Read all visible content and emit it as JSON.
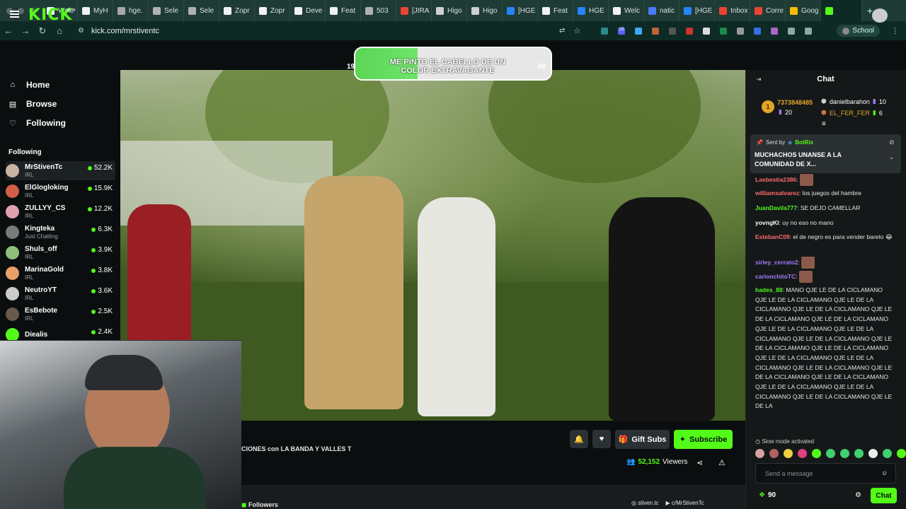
{
  "browser": {
    "tabs": [
      {
        "label": "Welc",
        "color": "#f2f2f2"
      },
      {
        "label": "MyH",
        "color": "#f2f2f2"
      },
      {
        "label": "hge.",
        "color": "#a8a8a8"
      },
      {
        "label": "Sele",
        "color": "#b0b0b0"
      },
      {
        "label": "Sele",
        "color": "#b0b0b0"
      },
      {
        "label": "Zopr",
        "color": "#f2f2f2"
      },
      {
        "label": "Zopr",
        "color": "#f2f2f2"
      },
      {
        "label": "Deve",
        "color": "#f2f2f2"
      },
      {
        "label": "Feat",
        "color": "#f2f2f2"
      },
      {
        "label": "503",
        "color": "#b0b0b0"
      },
      {
        "label": "[JIRA",
        "color": "#ea4335"
      },
      {
        "label": "Higo",
        "color": "#d0d0d0"
      },
      {
        "label": "Higo",
        "color": "#d0d0d0"
      },
      {
        "label": "[HGE",
        "color": "#2684ff"
      },
      {
        "label": "Feat",
        "color": "#f2f2f2"
      },
      {
        "label": "HGE",
        "color": "#2684ff"
      },
      {
        "label": "Welc",
        "color": "#f2f2f2"
      },
      {
        "label": "natic",
        "color": "#4a7cff"
      },
      {
        "label": "[HGE",
        "color": "#2684ff"
      },
      {
        "label": "Inbox",
        "color": "#ea4335"
      },
      {
        "label": "Corre",
        "color": "#ea4335"
      },
      {
        "label": "Goog",
        "color": "#fbbc05"
      },
      {
        "label": "",
        "color": "#53fc18"
      }
    ],
    "new_tab": "+",
    "url": "kick.com/mrstiventc",
    "profile_label": "School",
    "ext_badge": "25"
  },
  "header": {
    "logo": "KICK",
    "beta": "BETA"
  },
  "poll": {
    "question": "ME PINTO EL CABELLO DE UN COLOR EXTRAVAGANTE",
    "left_value": "19",
    "right_value": "50",
    "progress": 0.32
  },
  "sidebar": {
    "nav": [
      {
        "label": "Home",
        "icon": "home-icon"
      },
      {
        "label": "Browse",
        "icon": "browse-icon"
      },
      {
        "label": "Following",
        "icon": "heart-icon"
      }
    ],
    "following_heading": "Following",
    "following": [
      {
        "name": "MrStivenTc",
        "category": "IRL",
        "viewers": "52.2K",
        "color": "#c9b4a4"
      },
      {
        "name": "ElGlogloking",
        "category": "IRL",
        "viewers": "15.9K",
        "color": "#d45d4a"
      },
      {
        "name": "ZULLYY_CS",
        "category": "IRL",
        "viewers": "12.2K",
        "color": "#e0a0b0"
      },
      {
        "name": "Kingteka",
        "category": "Just Chatting",
        "viewers": "6.3K",
        "color": "#7a7a7a"
      },
      {
        "name": "Shuls_off",
        "category": "IRL",
        "viewers": "3.9K",
        "color": "#8ec07c"
      },
      {
        "name": "MarinaGold",
        "category": "IRL",
        "viewers": "3.8K",
        "color": "#e8a06a"
      },
      {
        "name": "NeutroYT",
        "category": "IRL",
        "viewers": "3.6K",
        "color": "#cccccc"
      },
      {
        "name": "EsBebote",
        "category": "IRL",
        "viewers": "2.5K",
        "color": "#6a5a4a"
      },
      {
        "name": "Diealis",
        "category": "",
        "viewers": "2.4K",
        "color": "#53fc18"
      }
    ]
  },
  "stream": {
    "title": "CIONES con LA BANDA Y VALLES T",
    "gift_subs": "Gift Subs",
    "subscribe": "Subscribe",
    "viewers_count": "52,152",
    "viewers_label": "Viewers",
    "followers_label": "Followers",
    "social_1": "stiven.tc",
    "social_2": "c/MrStivenTc"
  },
  "chat": {
    "title": "Chat",
    "leaderboard": {
      "top_user": "7373848485",
      "top_count": "20",
      "user_2": "danielbarahon",
      "user_2_count": "10",
      "user_3": "EL_FER_FER",
      "user_3_count": "6",
      "rank": "1"
    },
    "pinned": {
      "sent_by": "Sent by",
      "author": "BotRix",
      "message": "MUCHACHOS UNANSE A LA COMUNIDAD DE X..."
    },
    "messages": [
      {
        "user": "Lasbestia2386",
        "text": "",
        "color": "#ff6b6b"
      },
      {
        "user": "williamsalvarez",
        "text": "los juegos del hambre",
        "color": "#ff6b6b"
      },
      {
        "user": "JuanDavila777",
        "text": "SE DEJO CAMELLAR",
        "color": "#53fc18"
      },
      {
        "user": "yovngKl",
        "text": "uy no eso no mano",
        "color": "#ffffff"
      },
      {
        "user": "EstebanC09",
        "text": "el de negro es para vender bareto 😂",
        "color": "#ff6b6b"
      },
      {
        "user": "sirley_cerrato2",
        "text": "",
        "color": "#a47bff"
      },
      {
        "user": "carlonchitoTC",
        "text": "",
        "color": "#a47bff"
      },
      {
        "user": "hades_88",
        "text": "MANO QJE LE DE LA CICLAMANO QJE LE DE LA CICLAMANO QJE LE DE LA CICLAMANO QJE LE DE LA CICLAMANO QJE LE DE LA CICLAMANO QJE LE DE LA CICLAMANO QJE LE DE LA CICLAMANO QJE LE DE LA CICLAMANO QJE LE DE LA CICLAMANO QJE LE DE LA CICLAMANO QJE LE DE LA CICLAMANO QJE LE DE LA CICLAMANO QJE LE DE LA CICLAMANO QJE LE DE LA CICLAMANO QJE LE DE LA CICLAMANO QJE LE DE LA CICLAMANO QJE LE DE LA CICLAMANO QJE LE DE LA CICLAMANO QJE LE DE LA CICLAMANO QJE LE DE LA",
        "color": "#53fc18"
      }
    ],
    "slow_mode": "Slow mode activated",
    "input_placeholder": "Send a message",
    "points": "90",
    "send_button": "Chat"
  }
}
